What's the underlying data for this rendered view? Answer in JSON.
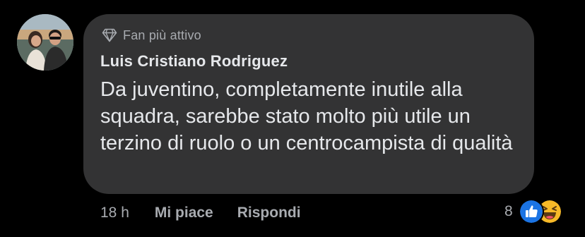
{
  "comment": {
    "badge_label": "Fan più attivo",
    "author": "Luis Cristiano Rodriguez",
    "text": "Da juventino, completamente inutile alla squadra, sarebbe stato molto più utile un terzino di ruolo o un centrocampista di qualità",
    "time": "18 h",
    "like_label": "Mi piace",
    "reply_label": "Rispondi",
    "reaction_count": "8",
    "reactions": [
      "like-reaction-icon",
      "haha-reaction-icon"
    ]
  },
  "colors": {
    "background": "#000000",
    "bubble": "#333334",
    "primary_text": "#e6e8eb",
    "secondary_text": "#a8abb0",
    "like_blue": "#1b74e4",
    "haha_yellow": "#f7b928"
  }
}
